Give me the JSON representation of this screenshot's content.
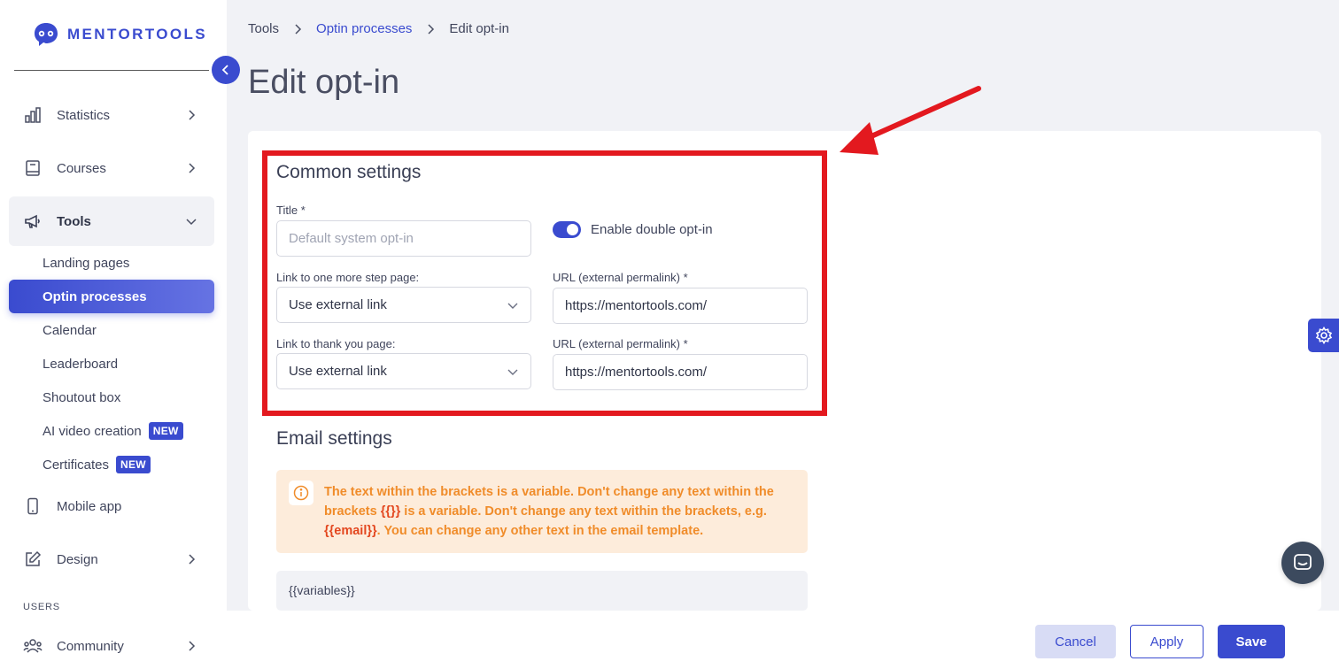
{
  "brand": {
    "name": "MENTORTOOLS"
  },
  "sidebar": {
    "items": [
      {
        "label": "Statistics",
        "icon": "bar-chart-icon"
      },
      {
        "label": "Courses",
        "icon": "book-icon"
      },
      {
        "label": "Tools",
        "icon": "megaphone-icon",
        "expanded": true
      },
      {
        "label": "Mobile app",
        "icon": "phone-icon"
      },
      {
        "label": "Design",
        "icon": "edit-icon"
      },
      {
        "label": "Community",
        "icon": "users-icon"
      }
    ],
    "tools_subitems": [
      {
        "label": "Landing pages"
      },
      {
        "label": "Optin processes",
        "selected": true
      },
      {
        "label": "Calendar"
      },
      {
        "label": "Leaderboard"
      },
      {
        "label": "Shoutout box"
      },
      {
        "label": "AI video creation",
        "badge": "NEW"
      },
      {
        "label": "Certificates",
        "badge": "NEW"
      }
    ],
    "section_users": "USERS"
  },
  "breadcrumb": {
    "root": "Tools",
    "parent": "Optin processes",
    "current": "Edit opt-in"
  },
  "page": {
    "title": "Edit opt-in"
  },
  "common_settings": {
    "heading": "Common settings",
    "title_label": "Title *",
    "title_placeholder": "Default system opt-in",
    "double_optin_label": "Enable double opt-in",
    "double_optin_enabled": true,
    "step_page_label": "Link to one more step page:",
    "step_page_value": "Use external link",
    "url1_label": "URL (external permalink) *",
    "url1_value": "https://mentortools.com/",
    "thankyou_label": "Link to thank you page:",
    "thankyou_value": "Use external link",
    "url2_label": "URL (external permalink) *",
    "url2_value": "https://mentortools.com/"
  },
  "email_settings": {
    "heading": "Email settings",
    "info_part1": "The text within the brackets is a variable. Don't change any text within the brackets ",
    "info_var1": "{{}}",
    "info_part2": " is a variable. Don't change any text within the brackets, e.g. ",
    "info_var2": "{{email}}",
    "info_part3": ". You can change any other text in the email template.",
    "variables_label": "{{variables}}"
  },
  "footer": {
    "cancel": "Cancel",
    "apply": "Apply",
    "save": "Save"
  },
  "colors": {
    "accent": "#3a4bcf",
    "highlight": "#e3191f",
    "warning_bg": "#fdecdb",
    "warning_text": "#f08c2a"
  }
}
